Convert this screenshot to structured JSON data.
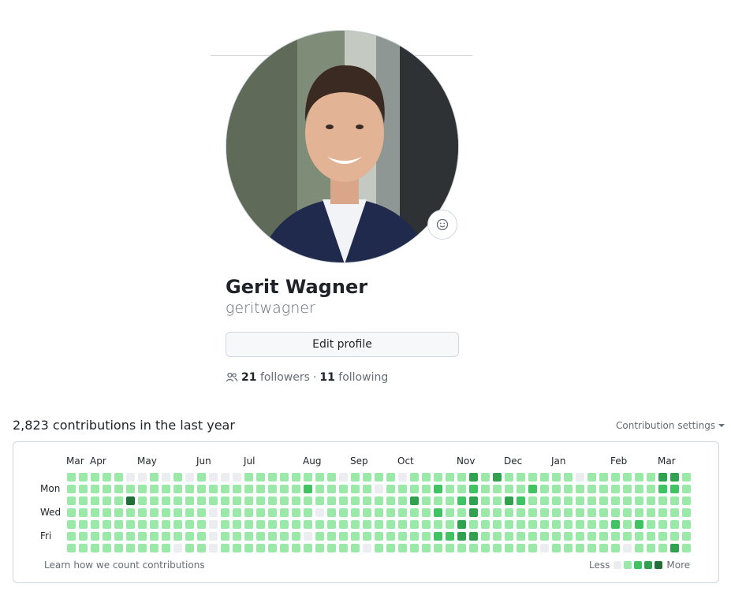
{
  "profile": {
    "name": "Gerit Wagner",
    "login": "geritwagner",
    "edit_label": "Edit profile",
    "followers_count": "21",
    "followers_label": "followers",
    "separator": "·",
    "following_count": "11",
    "following_label": "following"
  },
  "contributions": {
    "title": "2,823 contributions in the last year",
    "settings_label": "Contribution settings",
    "months": [
      "Mar",
      "Apr",
      "May",
      "Jun",
      "Jul",
      "Aug",
      "Sep",
      "Oct",
      "Nov",
      "Dec",
      "Jan",
      "Feb",
      "Mar"
    ],
    "days": [
      "Mon",
      "Wed",
      "Fri"
    ],
    "learn_label": "Learn how we count contributions",
    "legend_less": "Less",
    "legend_more": "More",
    "colors": [
      "#ebedf0",
      "#9be9a8",
      "#40c463",
      "#30a14e",
      "#216e39"
    ],
    "weeks": [
      [
        1,
        1,
        1,
        1,
        1,
        1,
        1
      ],
      [
        1,
        1,
        1,
        1,
        1,
        1,
        1
      ],
      [
        1,
        1,
        1,
        1,
        1,
        1,
        1
      ],
      [
        1,
        1,
        1,
        1,
        1,
        1,
        1
      ],
      [
        1,
        1,
        1,
        1,
        1,
        1,
        1
      ],
      [
        0,
        1,
        4,
        1,
        1,
        1,
        1
      ],
      [
        0,
        1,
        1,
        1,
        1,
        1,
        1
      ],
      [
        1,
        1,
        1,
        1,
        1,
        1,
        1
      ],
      [
        0,
        1,
        1,
        1,
        1,
        1,
        1
      ],
      [
        1,
        1,
        1,
        1,
        1,
        1,
        0
      ],
      [
        0,
        1,
        1,
        1,
        1,
        1,
        1
      ],
      [
        1,
        1,
        1,
        1,
        1,
        1,
        1
      ],
      [
        0,
        1,
        1,
        0,
        0,
        0,
        0
      ],
      [
        0,
        1,
        1,
        1,
        1,
        1,
        1
      ],
      [
        0,
        1,
        1,
        1,
        1,
        1,
        1
      ],
      [
        1,
        1,
        1,
        1,
        1,
        1,
        1
      ],
      [
        1,
        1,
        1,
        1,
        1,
        1,
        1
      ],
      [
        1,
        1,
        1,
        1,
        1,
        1,
        1
      ],
      [
        1,
        1,
        1,
        1,
        1,
        1,
        1
      ],
      [
        1,
        1,
        1,
        1,
        1,
        1,
        1
      ],
      [
        1,
        2,
        1,
        1,
        1,
        0,
        1
      ],
      [
        1,
        1,
        1,
        0,
        1,
        1,
        1
      ],
      [
        1,
        1,
        1,
        1,
        1,
        1,
        1
      ],
      [
        0,
        1,
        1,
        1,
        1,
        1,
        1
      ],
      [
        1,
        1,
        1,
        1,
        1,
        1,
        1
      ],
      [
        1,
        1,
        1,
        1,
        1,
        1,
        0
      ],
      [
        1,
        0,
        1,
        1,
        1,
        1,
        1
      ],
      [
        1,
        1,
        1,
        1,
        1,
        1,
        1
      ],
      [
        0,
        1,
        1,
        1,
        1,
        1,
        1
      ],
      [
        1,
        1,
        3,
        1,
        1,
        1,
        1
      ],
      [
        1,
        1,
        1,
        1,
        1,
        1,
        1
      ],
      [
        1,
        2,
        1,
        2,
        1,
        2,
        1
      ],
      [
        1,
        1,
        1,
        1,
        1,
        2,
        1
      ],
      [
        1,
        1,
        2,
        1,
        3,
        3,
        1
      ],
      [
        3,
        2,
        3,
        3,
        1,
        3,
        1
      ],
      [
        1,
        1,
        1,
        1,
        1,
        1,
        1
      ],
      [
        3,
        1,
        1,
        1,
        1,
        1,
        1
      ],
      [
        1,
        1,
        3,
        1,
        1,
        1,
        1
      ],
      [
        1,
        1,
        2,
        1,
        1,
        1,
        1
      ],
      [
        1,
        2,
        1,
        1,
        1,
        1,
        1
      ],
      [
        1,
        1,
        1,
        1,
        1,
        1,
        0
      ],
      [
        1,
        1,
        1,
        1,
        1,
        1,
        1
      ],
      [
        1,
        1,
        1,
        1,
        1,
        1,
        1
      ],
      [
        0,
        1,
        1,
        1,
        1,
        1,
        1
      ],
      [
        1,
        1,
        1,
        1,
        1,
        1,
        1
      ],
      [
        1,
        1,
        1,
        1,
        1,
        1,
        1
      ],
      [
        1,
        1,
        1,
        1,
        2,
        1,
        1
      ],
      [
        1,
        1,
        1,
        1,
        1,
        1,
        0
      ],
      [
        1,
        1,
        1,
        1,
        2,
        1,
        1
      ],
      [
        1,
        1,
        1,
        1,
        1,
        1,
        1
      ],
      [
        3,
        2,
        1,
        1,
        1,
        1,
        1
      ],
      [
        3,
        2,
        1,
        1,
        1,
        1,
        3
      ],
      [
        1,
        1,
        1,
        1,
        1,
        1,
        1
      ]
    ]
  }
}
